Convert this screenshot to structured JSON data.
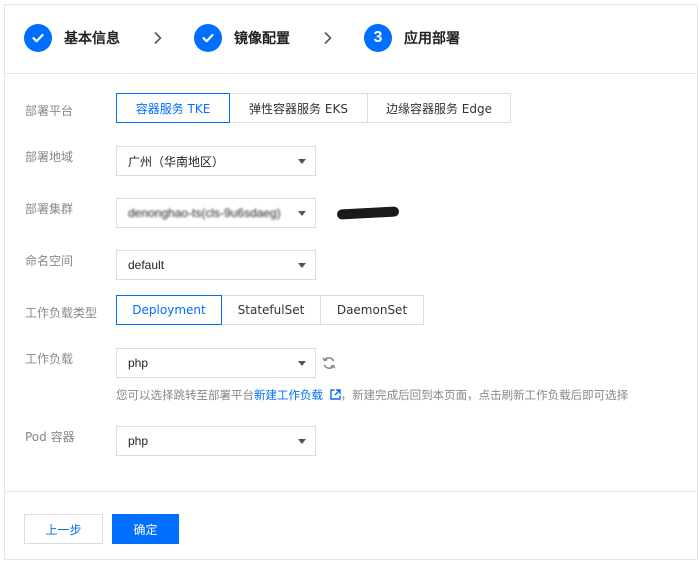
{
  "steps": [
    {
      "label": "基本信息",
      "state": "done",
      "icon": "check-icon"
    },
    {
      "label": "镜像配置",
      "state": "done",
      "icon": "check-icon"
    },
    {
      "label": "应用部署",
      "state": "current",
      "number": "3"
    }
  ],
  "form": {
    "platform": {
      "label": "部署平台",
      "options": [
        "容器服务 TKE",
        "弹性容器服务 EKS",
        "边缘容器服务 Edge"
      ],
      "selected": "容器服务 TKE"
    },
    "region": {
      "label": "部署地域",
      "value": "广州（华南地区）"
    },
    "cluster": {
      "label": "部署集群",
      "value": "denonghao-ts(cls-9u6sdaeg)"
    },
    "namespace": {
      "label": "命名空间",
      "value": "default"
    },
    "workload_type": {
      "label": "工作负载类型",
      "options": [
        "Deployment",
        "StatefulSet",
        "DaemonSet"
      ],
      "selected": "Deployment"
    },
    "workload": {
      "label": "工作负载",
      "value": "php",
      "refresh_icon": "refresh-icon"
    },
    "hint": {
      "prefix": "您可以选择跳转至部署平台",
      "link": "新建工作负载",
      "link_icon": "external-link-icon",
      "suffix": "，新建完成后回到本页面，点击刷新工作负载后即可选择"
    },
    "container": {
      "label": "Pod 容器",
      "value": "php"
    }
  },
  "footer": {
    "prev_label": "上一步",
    "ok_label": "确定"
  },
  "colors": {
    "accent": "#006eff",
    "border": "#dddddd",
    "label": "#888888"
  }
}
